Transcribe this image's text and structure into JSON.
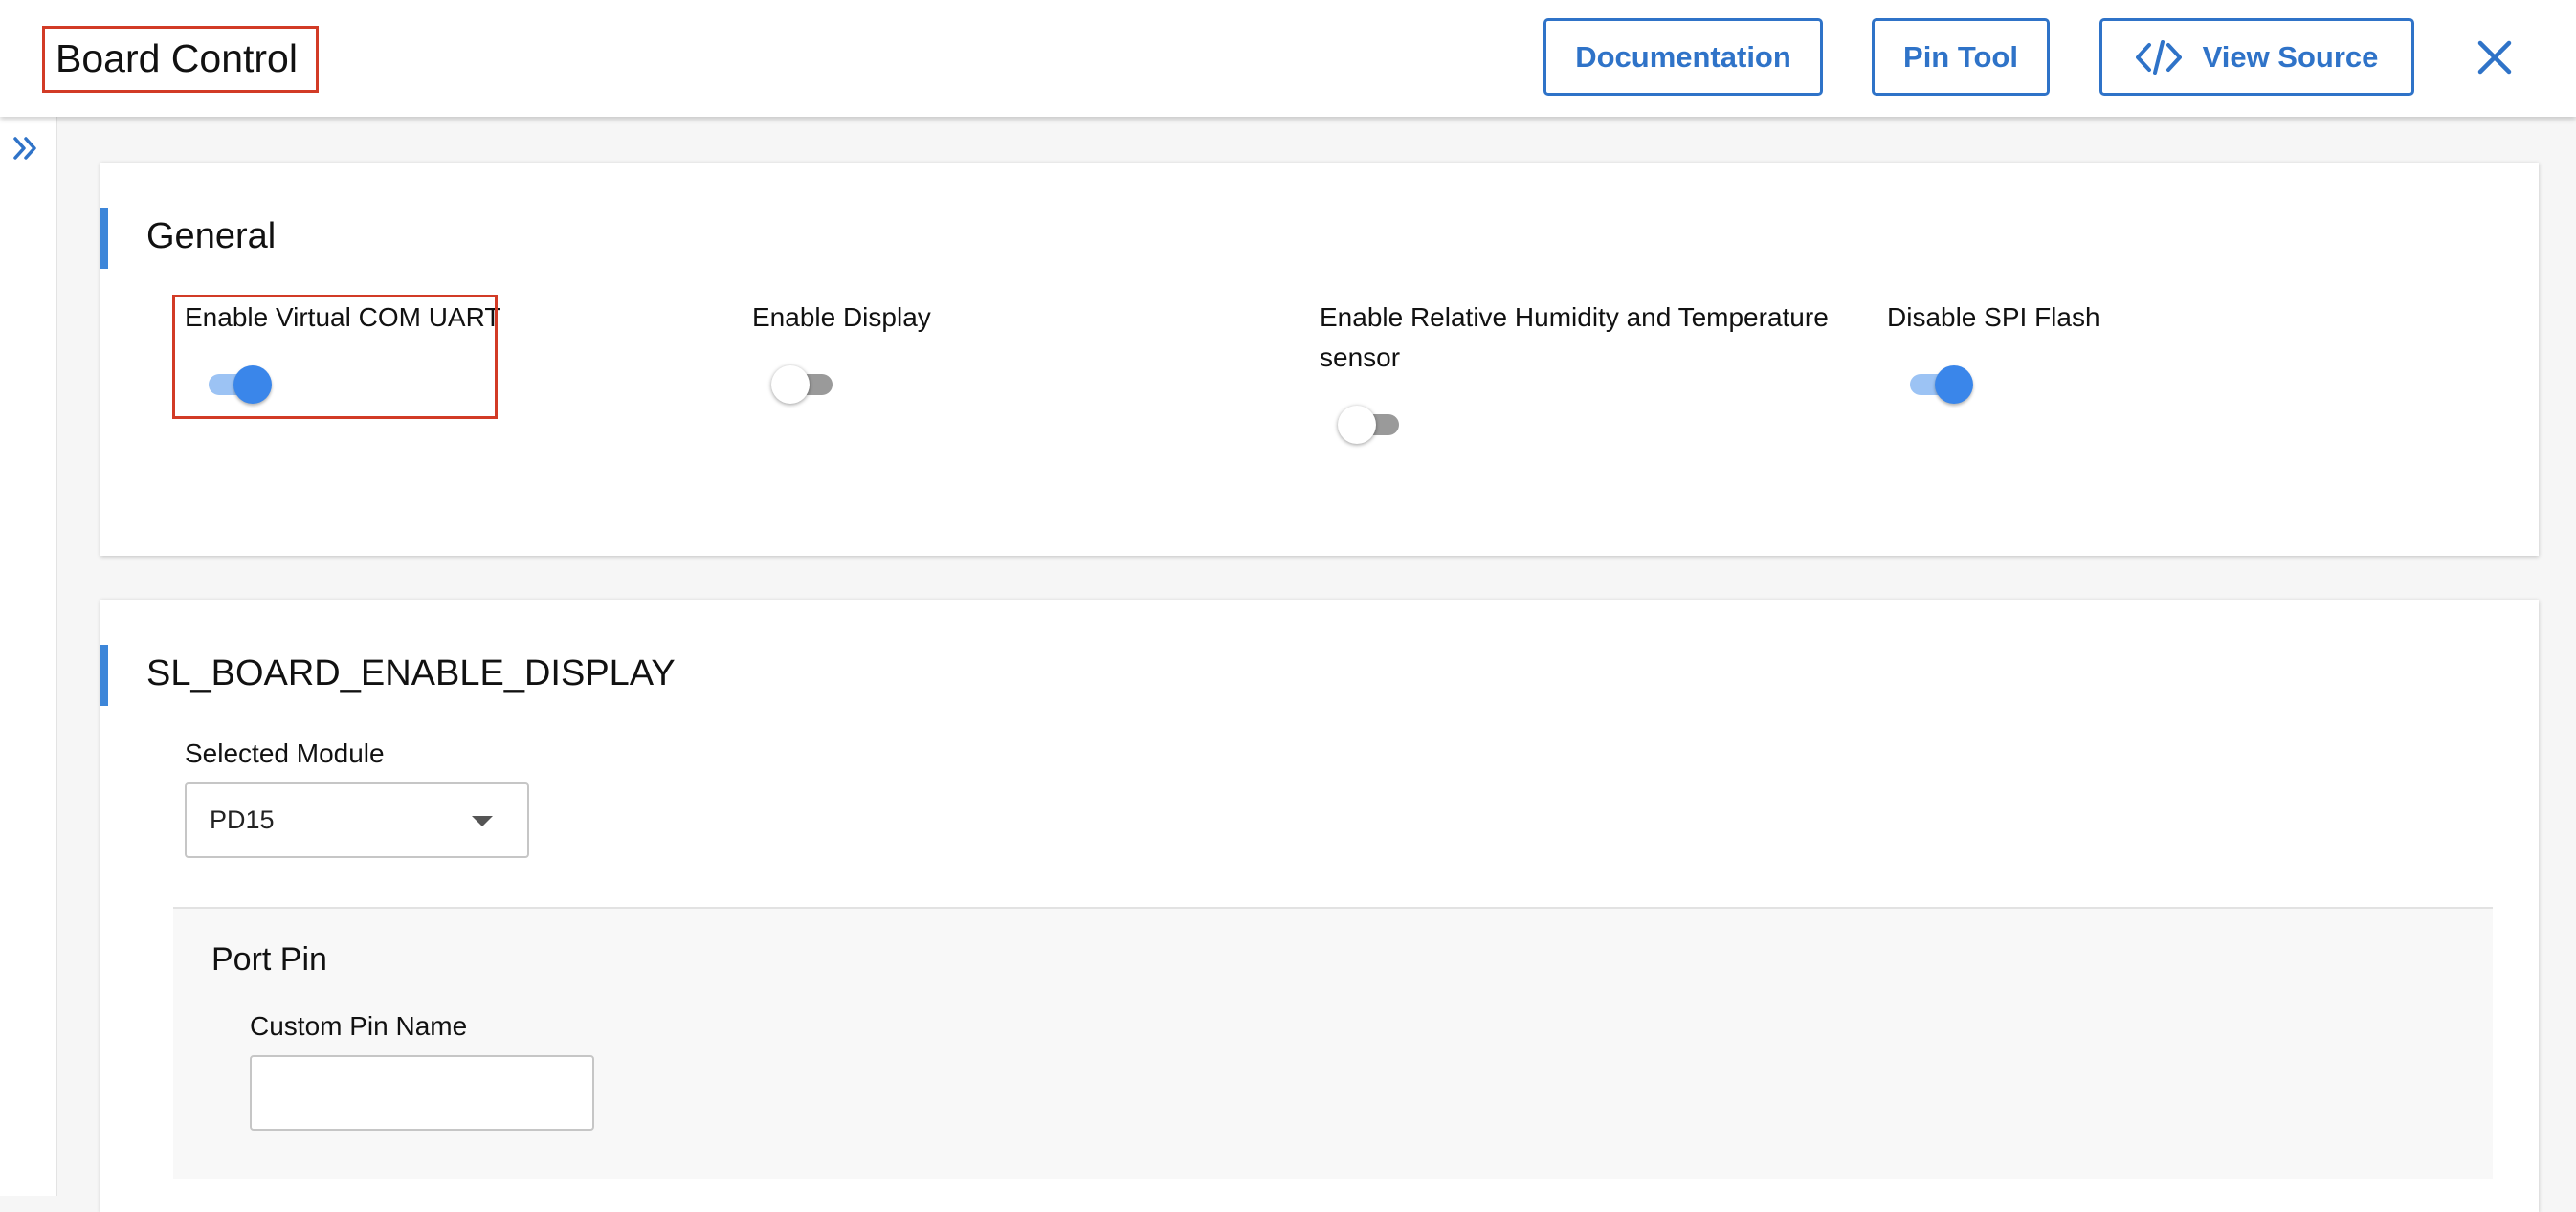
{
  "header": {
    "title": "Board Control",
    "documentation_label": "Documentation",
    "pin_tool_label": "Pin Tool",
    "view_source_label": "View Source",
    "icons": {
      "view_source": "code-icon",
      "close": "close-icon"
    }
  },
  "sidebar": {
    "expand_icon": "chevron-double-right-icon"
  },
  "general": {
    "title": "General",
    "options": [
      {
        "label": "Enable Virtual COM UART",
        "enabled": true
      },
      {
        "label": "Enable Display",
        "enabled": false
      },
      {
        "label_line1": "Enable Relative Humidity and Temperature",
        "label_line2": "sensor",
        "enabled": false
      },
      {
        "label": "Disable SPI Flash",
        "enabled": true
      }
    ]
  },
  "display": {
    "title": "SL_BOARD_ENABLE_DISPLAY",
    "selected_module_label": "Selected Module",
    "selected_module_value": "PD15",
    "port_pin": {
      "title": "Port Pin",
      "custom_pin_name_label": "Custom Pin Name",
      "custom_pin_name_value": ""
    }
  },
  "colors": {
    "accent": "#3d86d9",
    "button": "#2f73c8",
    "highlight": "#d23b26",
    "toggle_on": "#3a86ea"
  }
}
